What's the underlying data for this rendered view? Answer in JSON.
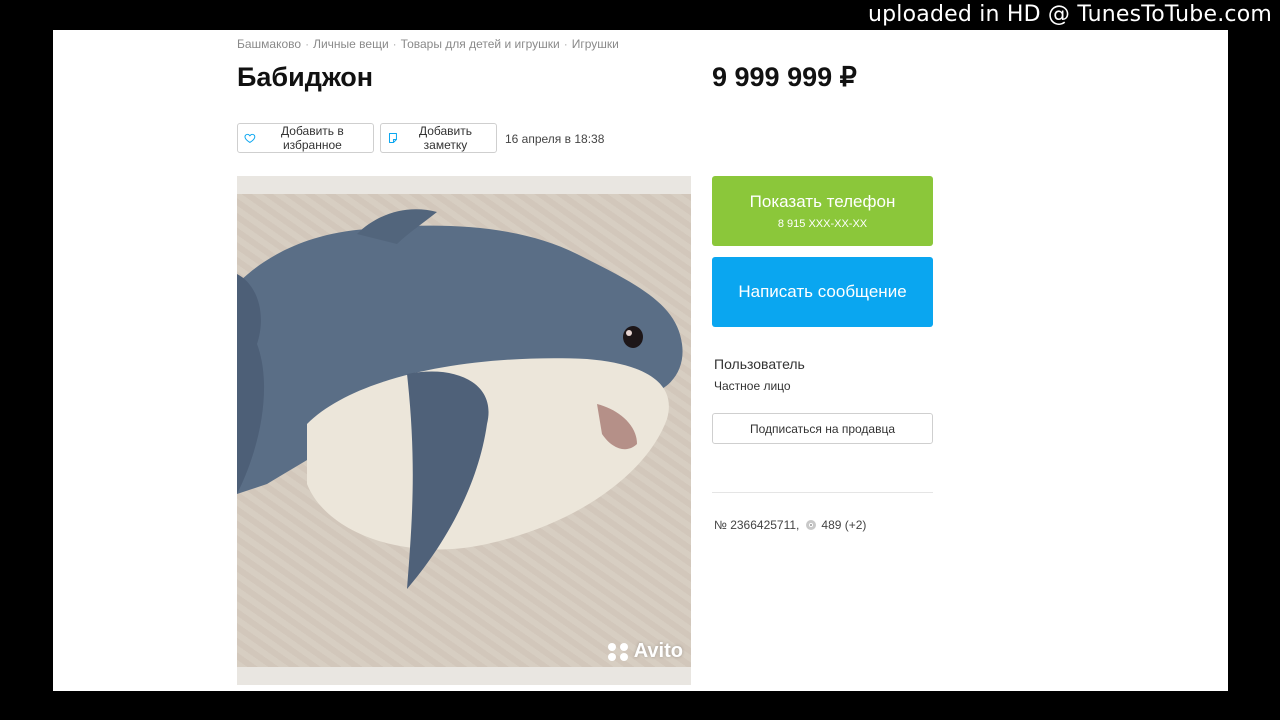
{
  "watermark": "uploaded in HD @ TunesToTube.com",
  "breadcrumb": [
    "Башмаково",
    "Личные вещи",
    "Товары для детей и игрушки",
    "Игрушки"
  ],
  "listing": {
    "title": "Бабиджон",
    "price": "9 999 999 ₽",
    "favorite_label": "Добавить в избранное",
    "note_label": "Добавить заметку",
    "date": "16 апреля в 18:38"
  },
  "photo": {
    "watermark": "Avito"
  },
  "contact": {
    "phone_label": "Показать телефон",
    "phone_masked": "8 915 XXX-XX-XX",
    "message_label": "Написать сообщение"
  },
  "seller": {
    "name": "Пользователь",
    "type": "Частное лицо",
    "subscribe_label": "Подписаться на продавца"
  },
  "meta": {
    "ad_number": "№ 2366425711,",
    "views": "489 (+2)"
  },
  "colors": {
    "phone_button": "#8bc73a",
    "message_button": "#0aa6f0",
    "favorite_icon": "#0aa6f0",
    "note_icon": "#0aa6f0"
  }
}
